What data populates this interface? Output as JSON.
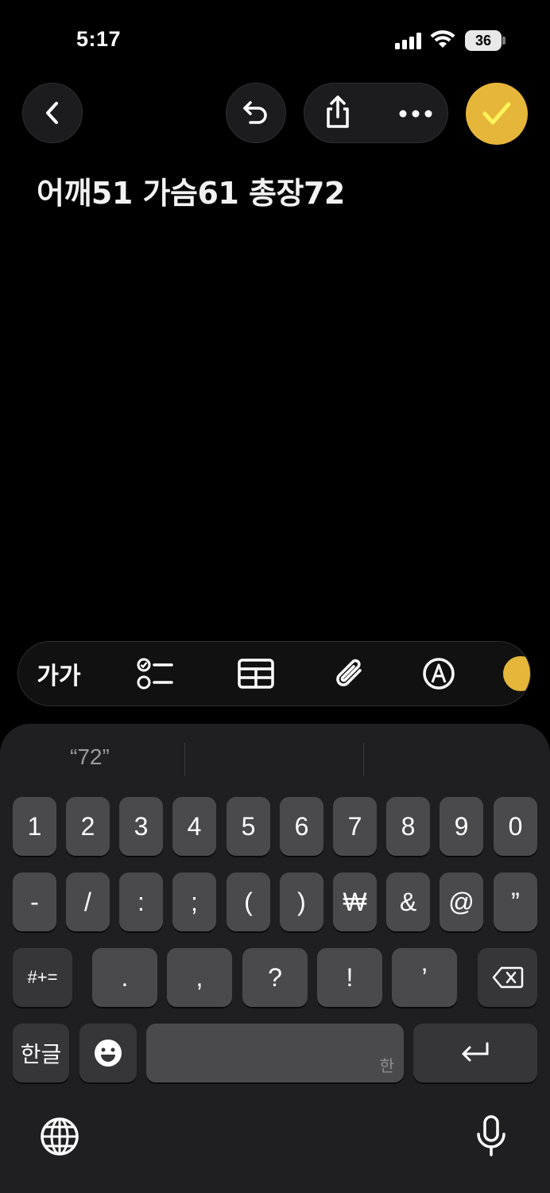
{
  "status_bar": {
    "time": "5:17",
    "battery": "36"
  },
  "nav": {
    "back_icon": "chevron-left-icon",
    "undo_icon": "undo-icon",
    "share_icon": "share-icon",
    "more_icon": "ellipsis-icon",
    "done_icon": "checkmark-icon",
    "done_color": "#e6b63a"
  },
  "note": {
    "text": "어깨51 가슴61 총장72"
  },
  "toolbar": {
    "format_label": "가가",
    "items": [
      "text-format-icon",
      "checklist-icon",
      "table-icon",
      "attachment-icon",
      "markup-icon",
      "apple-intelligence-icon"
    ]
  },
  "keyboard": {
    "suggestion": "“72”",
    "row1": [
      "1",
      "2",
      "3",
      "4",
      "5",
      "6",
      "7",
      "8",
      "9",
      "0"
    ],
    "row2": [
      "-",
      "/",
      ":",
      ";",
      "(",
      ")",
      "₩",
      "&",
      "@",
      "”"
    ],
    "row3": [
      "#+=",
      ".",
      ",",
      "?",
      "!",
      "’"
    ],
    "hangul_key": "한글",
    "space_hint": "한"
  }
}
